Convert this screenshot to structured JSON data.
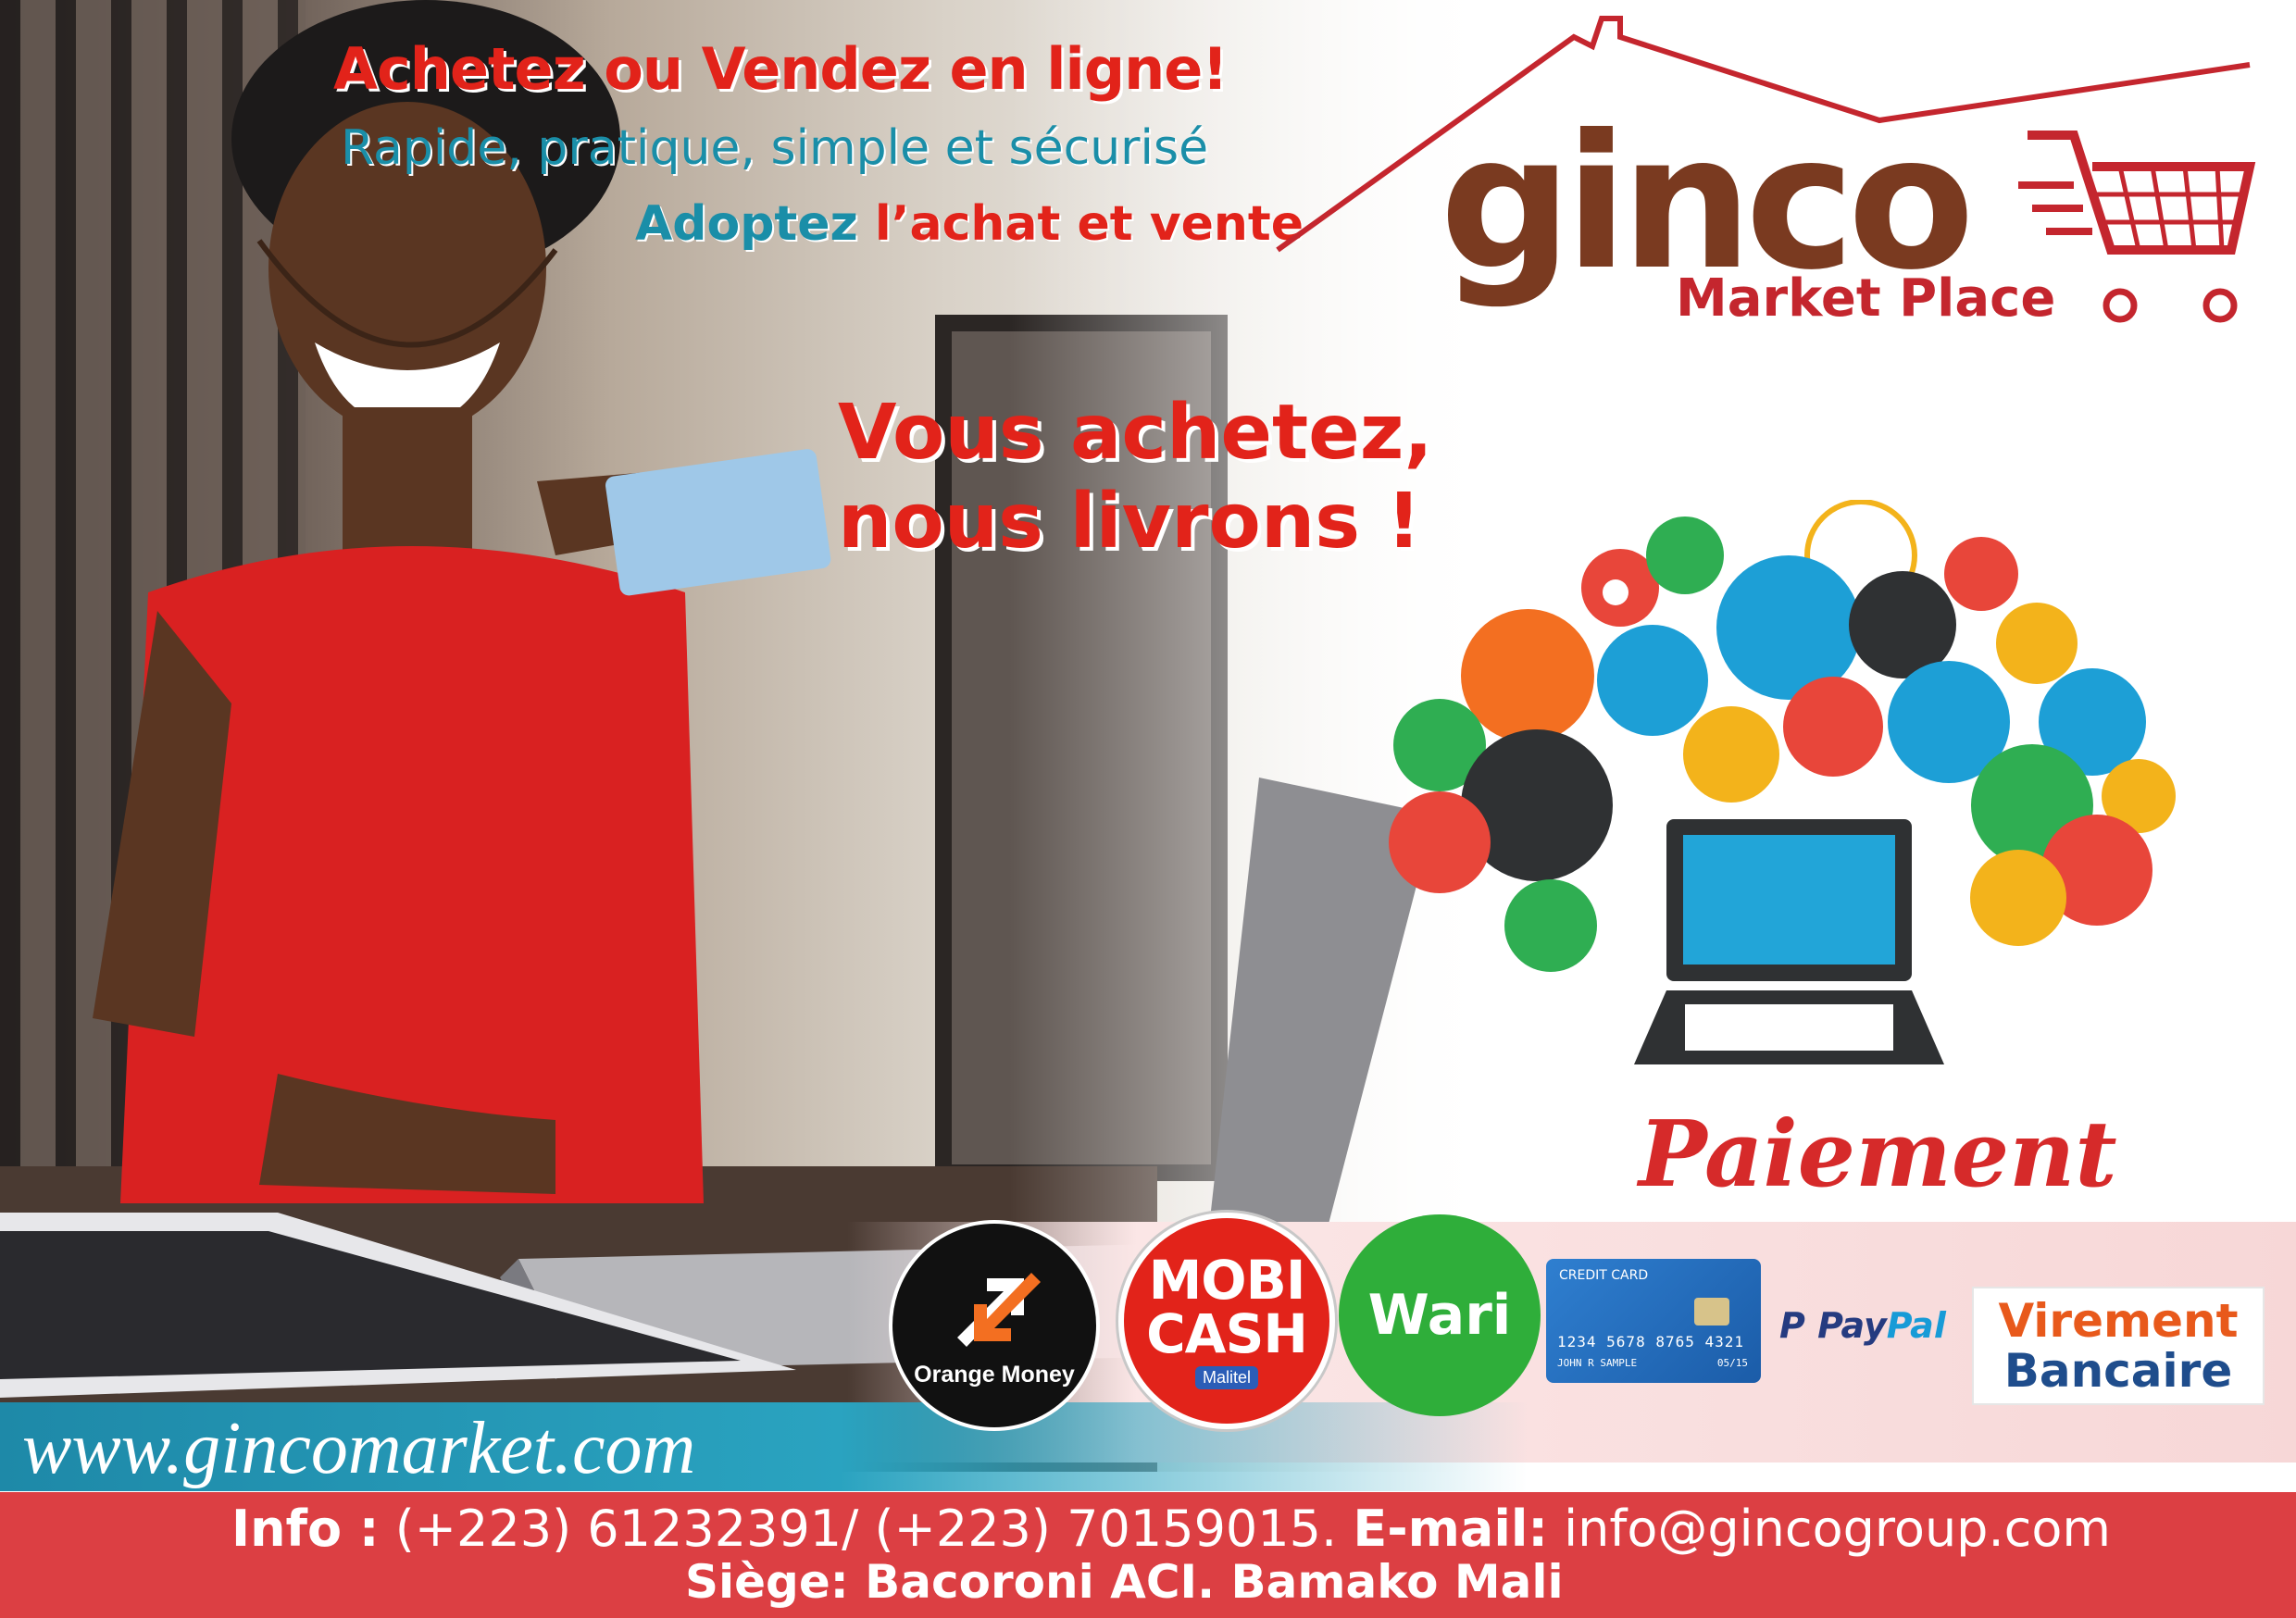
{
  "headline": {
    "line1": "Achetez ou Vendez en ligne!",
    "line2": "Rapide, pratique, simple et sécurisé",
    "line3_a": "Adoptez",
    "line3_b": "l’achat et vente"
  },
  "slogan": {
    "line1": "Vous achetez,",
    "line2": "nous livrons !"
  },
  "logo": {
    "word": "ginco",
    "sub": "Market Place"
  },
  "payment": {
    "title": "Paiement",
    "orange_money": "Orange Money",
    "mobicash_1": "MOBI",
    "mobicash_2": "CASH",
    "mobicash_badge": "Malitel",
    "wari": "Wari",
    "card_label": "CREDIT CARD",
    "card_number": "1234 5678 8765 4321",
    "card_holder": "JOHN R SAMPLE",
    "card_expiry": "05/15",
    "paypal_1": "Pay",
    "paypal_2": "Pal",
    "virement_1": "Virement",
    "virement_2": "Bancaire"
  },
  "footer": {
    "url": "www.gincomarket.com",
    "info_label": "Info :",
    "phones": " (+223) 61232391/ (+223) 70159015.",
    "email_label": "E-mail:",
    "email": " info@gincogroup.com",
    "address": "Siège: Bacoroni ACI. Bamako Mali"
  },
  "icons": [
    "bead-icon",
    "clock-icon",
    "tie-icon",
    "house-icon",
    "phone-icon",
    "music-icon",
    "lipstick-icon",
    "laptop-icon",
    "coffee-icon",
    "bag-icon",
    "car-icon",
    "gift-icon",
    "plane-icon",
    "pencil-icon",
    "hanger-icon",
    "wine-icon",
    "glasses-icon",
    "book-icon",
    "heel-icon",
    "camera-icon",
    "bicycle-icon",
    "star-icon"
  ],
  "colors": {
    "red": "#e2231a",
    "teal": "#1a8ea8",
    "brown": "#7a3a20",
    "footer_red": "#dc3f43"
  }
}
